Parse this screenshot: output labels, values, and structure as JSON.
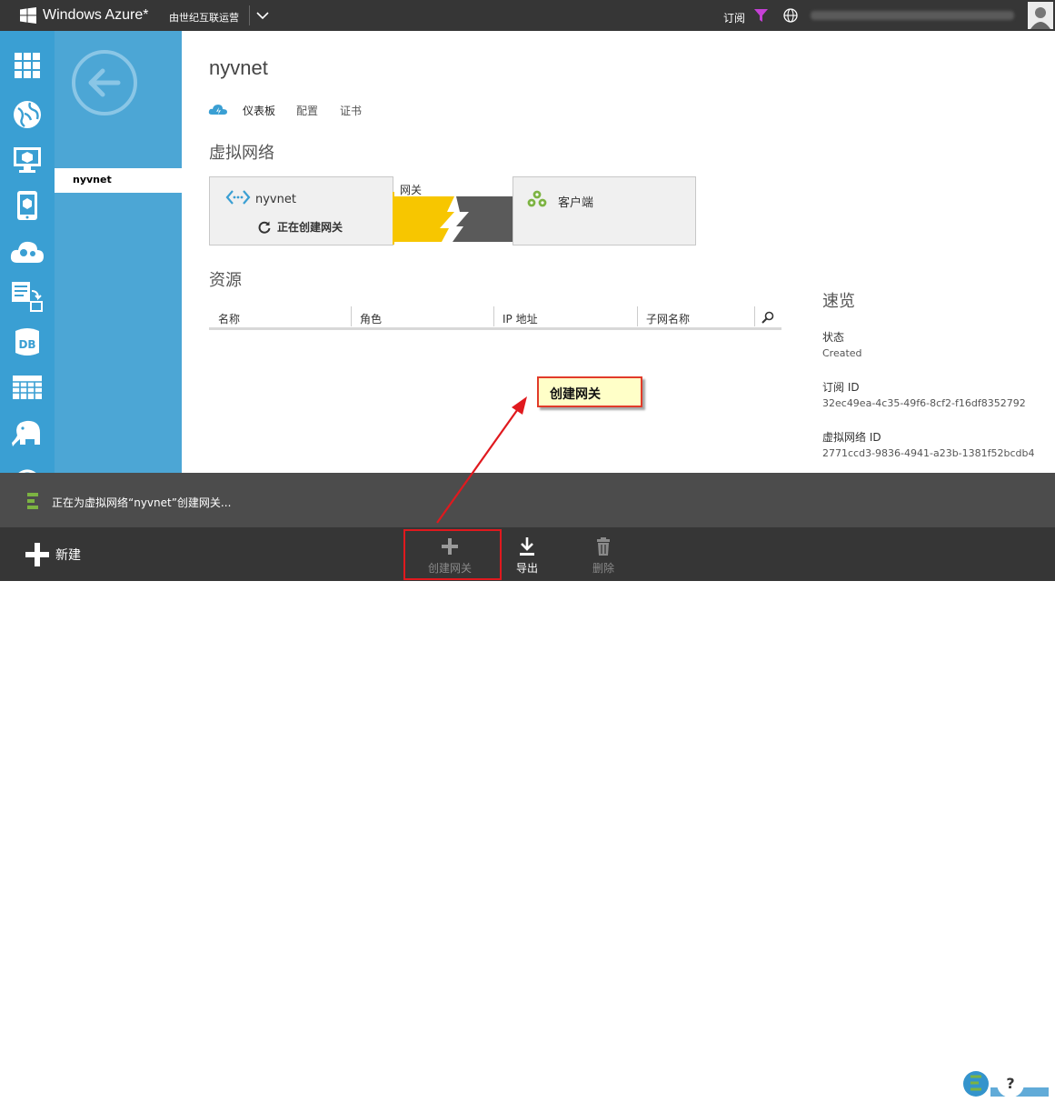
{
  "header": {
    "brand": "Windows Azure*",
    "partner": "由世纪互联运营",
    "subscriptions": "订阅"
  },
  "subnav": {
    "active_item": "nyvnet"
  },
  "main": {
    "title": "nyvnet",
    "tabs": [
      {
        "label": "仪表板",
        "active": true
      },
      {
        "label": "配置",
        "active": false
      },
      {
        "label": "证书",
        "active": false
      }
    ],
    "vnet_section": {
      "heading": "虚拟网络",
      "network_name": "nyvnet",
      "status": "正在创建网关",
      "gateway_label": "网关",
      "client_label": "客户端"
    },
    "resources": {
      "heading": "资源",
      "columns": [
        "名称",
        "角色",
        "IP 地址",
        "子网名称"
      ]
    }
  },
  "quick_glance": {
    "heading": "速览",
    "status_label": "状态",
    "status_value": "Created",
    "subscription_id_label": "订阅 ID",
    "subscription_id_value": "32ec49ea-4c35-49f6-8cf2-f16df8352792",
    "vnet_id_label": "虚拟网络 ID",
    "vnet_id_value": "2771ccd3-9836-4941-a23b-1381f52bcdb4"
  },
  "annotation": {
    "callout": "创建网关"
  },
  "notification": {
    "message": "正在为虚拟网络“nyvnet”创建网关..."
  },
  "commands": {
    "new": "新建",
    "create_gateway": "创建网关",
    "export": "导出",
    "delete": "删除"
  },
  "colors": {
    "accent_blue": "#3a9fd3",
    "bar_dark": "#363636",
    "gateway_yellow": "#f7c600",
    "highlight_red": "#e0191e"
  }
}
